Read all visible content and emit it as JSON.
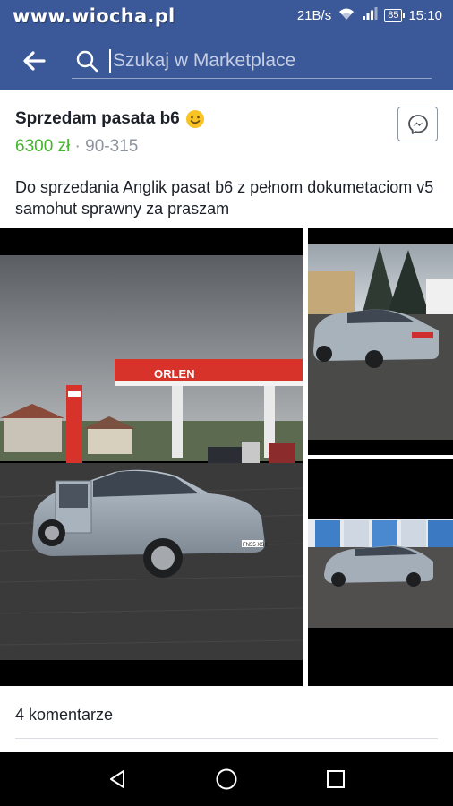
{
  "status_bar": {
    "watermark": "www.wiocha.pl",
    "network_speed": "21B/s",
    "battery": "85",
    "time": "15:10"
  },
  "app_bar": {
    "search_placeholder": "Szukaj w Marketplace"
  },
  "listing": {
    "title": "Sprzedam pasata b6",
    "price": "6300 zł",
    "separator": " · ",
    "location": "90-315",
    "description": "Do sprzedania Anglik pasat b6 z pełnom dokumetaciom v5  samohut sprawny za praszam",
    "photos": [
      {
        "name": "photo-main",
        "desc": "car-at-orlen-station"
      },
      {
        "name": "photo-side-1",
        "desc": "car-rear-view"
      },
      {
        "name": "photo-side-2",
        "desc": "car-side-view"
      }
    ],
    "orlen_sign": "ORLEN",
    "plate": "FN55 XSK"
  },
  "comments": {
    "count_label": "4 komentarze"
  },
  "colors": {
    "brand": "#3b5998",
    "price": "#42b72a",
    "text": "#1d2129",
    "muted": "#8d949e"
  },
  "icons": [
    "wifi-icon",
    "signal-icon",
    "battery-icon",
    "back-arrow-icon",
    "search-icon",
    "smile-emoji-icon",
    "messenger-icon",
    "nav-back-icon",
    "nav-home-icon",
    "nav-recents-icon"
  ]
}
